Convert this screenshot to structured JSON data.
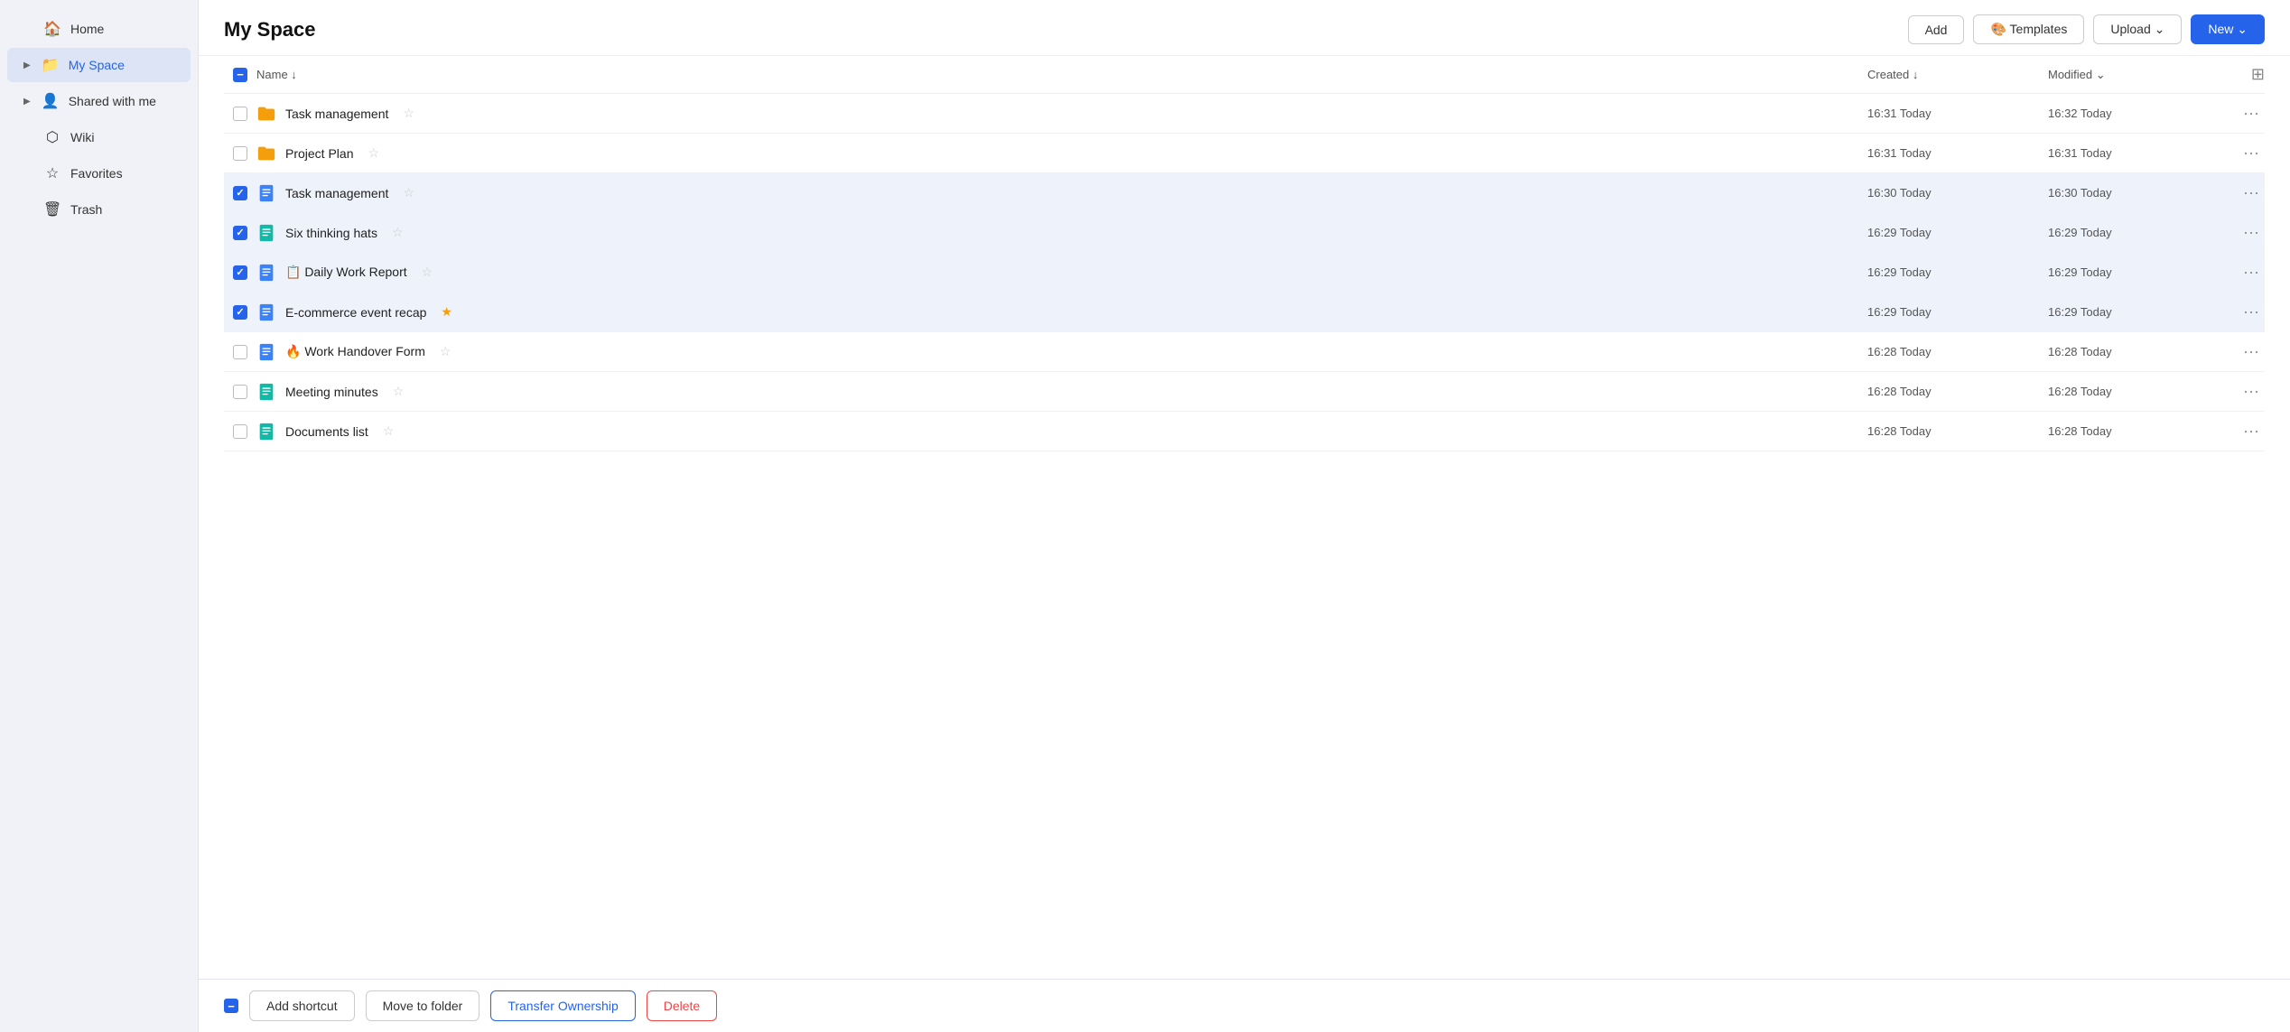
{
  "sidebar": {
    "items": [
      {
        "id": "home",
        "label": "Home",
        "icon": "🏠",
        "arrow": "",
        "active": false
      },
      {
        "id": "myspace",
        "label": "My Space",
        "icon": "📁",
        "arrow": "▶",
        "active": true
      },
      {
        "id": "sharedwithme",
        "label": "Shared with me",
        "icon": "👤",
        "arrow": "▶",
        "active": false
      },
      {
        "id": "wiki",
        "label": "Wiki",
        "icon": "⬡",
        "arrow": "",
        "active": false
      },
      {
        "id": "favorites",
        "label": "Favorites",
        "icon": "☆",
        "arrow": "",
        "active": false
      },
      {
        "id": "trash",
        "label": "Trash",
        "icon": "🗑",
        "arrow": "",
        "active": false
      }
    ]
  },
  "header": {
    "title": "My Space",
    "add_label": "Add",
    "templates_label": "🎨 Templates",
    "upload_label": "Upload ⌄",
    "new_label": "New ⌄"
  },
  "table": {
    "columns": [
      {
        "id": "name",
        "label": "Name ↓"
      },
      {
        "id": "created",
        "label": "Created ↓"
      },
      {
        "id": "modified",
        "label": "Modified ⌄"
      }
    ],
    "rows": [
      {
        "id": 1,
        "name": "Task management",
        "icon": "folder",
        "created": "16:31 Today",
        "modified": "16:32 Today",
        "checked": false,
        "starred": false
      },
      {
        "id": 2,
        "name": "Project Plan",
        "icon": "folder",
        "created": "16:31 Today",
        "modified": "16:31 Today",
        "checked": false,
        "starred": false
      },
      {
        "id": 3,
        "name": "Task management",
        "icon": "doc-blue",
        "created": "16:30 Today",
        "modified": "16:30 Today",
        "checked": true,
        "starred": false
      },
      {
        "id": 4,
        "name": "Six thinking hats",
        "icon": "doc-teal",
        "created": "16:29 Today",
        "modified": "16:29 Today",
        "checked": true,
        "starred": false
      },
      {
        "id": 5,
        "name": "📋 Daily Work Report",
        "icon": "doc-blue",
        "created": "16:29 Today",
        "modified": "16:29 Today",
        "checked": true,
        "starred": false
      },
      {
        "id": 6,
        "name": "E-commerce event recap",
        "icon": "doc-blue",
        "created": "16:29 Today",
        "modified": "16:29 Today",
        "checked": true,
        "starred": true
      },
      {
        "id": 7,
        "name": "🔥 Work Handover Form",
        "icon": "doc-blue",
        "created": "16:28 Today",
        "modified": "16:28 Today",
        "checked": false,
        "starred": false
      },
      {
        "id": 8,
        "name": "Meeting minutes",
        "icon": "doc-teal",
        "created": "16:28 Today",
        "modified": "16:28 Today",
        "checked": false,
        "starred": false
      },
      {
        "id": 9,
        "name": "Documents list",
        "icon": "doc-teal",
        "created": "16:28 Today",
        "modified": "16:28 Today",
        "checked": false,
        "starred": false
      }
    ]
  },
  "action_bar": {
    "add_shortcut": "Add shortcut",
    "move_to_folder": "Move to folder",
    "transfer_ownership": "Transfer Ownership",
    "delete": "Delete"
  }
}
